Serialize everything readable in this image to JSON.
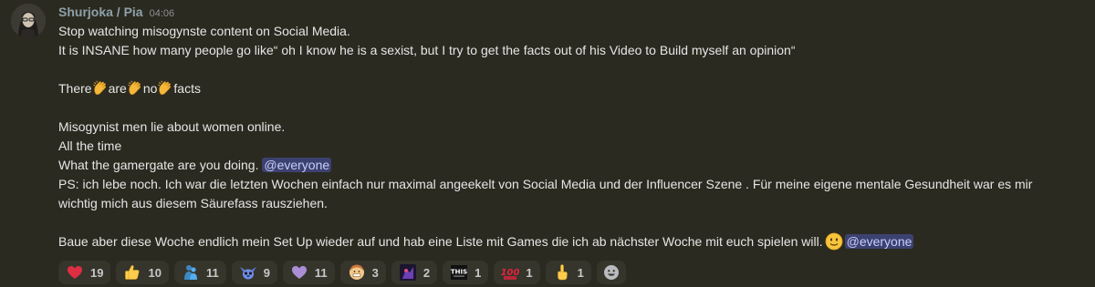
{
  "message": {
    "author": "Shurjoka / Pia",
    "timestamp": "04:06",
    "lines": {
      "l1": "Stop watching misogynste content on Social Media.",
      "l2": "It is INSANE how many people go like“ oh I know he is a sexist, but I try to get the facts out of his Video to Build myself an opinion“",
      "facts": {
        "w1": "There",
        "w2": "are",
        "w3": "no",
        "w4": "facts"
      },
      "l4": "Misogynist men lie about women online.",
      "l5": "All the time",
      "l6": "What the gamergate are you doing. ",
      "mention": "@everyone",
      "l7": "PS: ich lebe noch. Ich war die letzten Wochen einfach nur maximal angeekelt von Social Media und der Influencer Szene . Für meine eigene mentale Gesundheit war es mir",
      "l8": "wichtig mich aus diesem Säurefass rausziehen.",
      "l9": "Baue aber diese Woche endlich mein Set Up wieder auf und hab eine Liste mit Games die ich ab nächster Woche mit euch spielen will."
    }
  },
  "reactions": [
    {
      "icon": "heart-emoji-icon",
      "count": "19"
    },
    {
      "icon": "thumbs-up-emoji-icon",
      "count": "10"
    },
    {
      "icon": "hug-emoji-icon",
      "count": "11"
    },
    {
      "icon": "stitch-emoji-icon",
      "count": "9"
    },
    {
      "icon": "purple-heart-emoji-icon",
      "count": "11"
    },
    {
      "icon": "grimace-emoji-icon",
      "count": "3"
    },
    {
      "icon": "custom-emoji-icon",
      "count": "2"
    },
    {
      "icon": "this-emoji-icon",
      "count": "1"
    },
    {
      "icon": "hundred-emoji-icon",
      "count": "1"
    },
    {
      "icon": "point-up-emoji-icon",
      "count": "1"
    }
  ],
  "colors": {
    "background": "#2b2a20",
    "mention_bg": "#3c4270",
    "mention_text": "#c9cdfb",
    "username": "#8ea0a8"
  }
}
